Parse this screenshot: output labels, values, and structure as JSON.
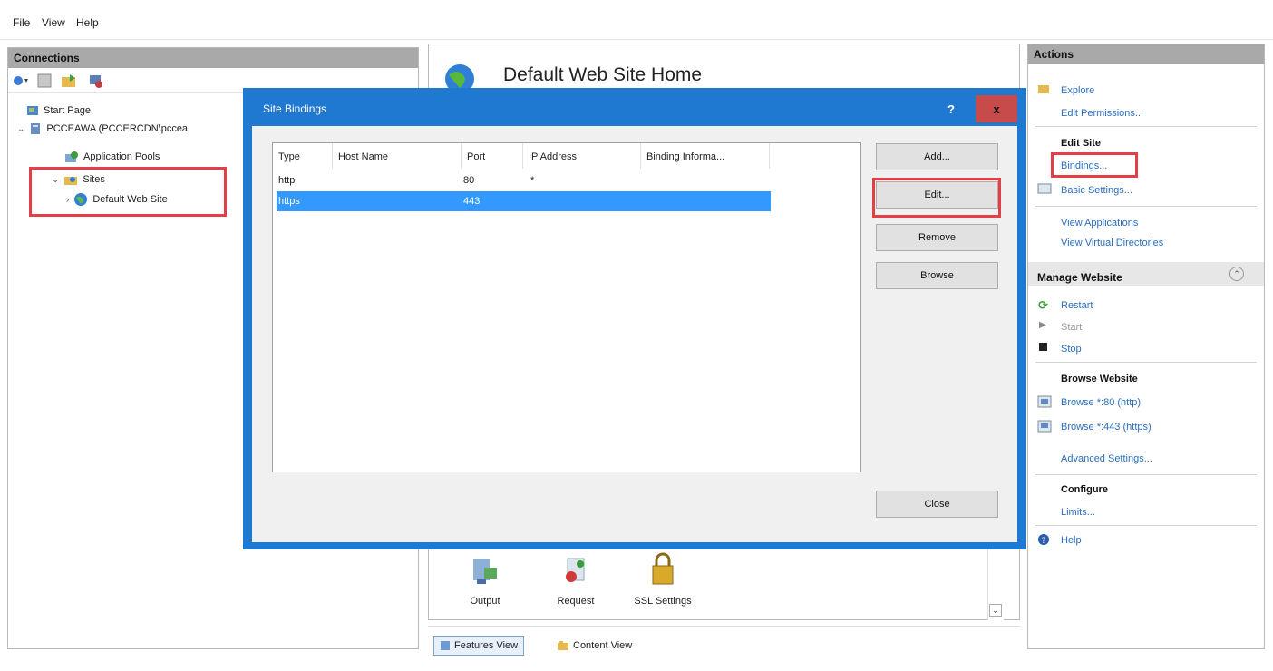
{
  "menu": [
    "File",
    "View",
    "Help"
  ],
  "connections": {
    "header": "Connections",
    "tree": {
      "start_page": "Start Page",
      "server": "PCCEAWA (PCCERCDN\\pccea",
      "app_pools": "Application Pools",
      "sites": "Sites",
      "default_site": "Default Web Site"
    }
  },
  "center": {
    "title": "Default Web Site Home",
    "features": [
      "Output",
      "Request",
      "SSL Settings"
    ],
    "views": {
      "features": "Features View",
      "content": "Content View"
    }
  },
  "actions": {
    "header": "Actions",
    "explore": "Explore",
    "edit_permissions": "Edit Permissions...",
    "edit_site": "Edit Site",
    "bindings": "Bindings...",
    "basic_settings": "Basic Settings...",
    "view_apps": "View Applications",
    "view_vdirs": "View Virtual Directories",
    "manage_website": "Manage Website",
    "restart": "Restart",
    "start": "Start",
    "stop": "Stop",
    "browse_website": "Browse Website",
    "browse80": "Browse *:80 (http)",
    "browse443": "Browse *:443 (https)",
    "advanced": "Advanced Settings...",
    "configure": "Configure",
    "limits": "Limits...",
    "help": "Help"
  },
  "dialog": {
    "title": "Site Bindings",
    "help_btn": "?",
    "close_x": "x",
    "columns": [
      "Type",
      "Host Name",
      "Port",
      "IP Address",
      "Binding Informa..."
    ],
    "rows": [
      {
        "type": "http",
        "host": "",
        "port": "80",
        "ip": "*"
      },
      {
        "type": "https",
        "host": "",
        "port": "443",
        "ip": ""
      }
    ],
    "buttons": {
      "add": "Add...",
      "edit": "Edit...",
      "remove": "Remove",
      "browse": "Browse",
      "close": "Close"
    }
  },
  "colors": {
    "dialog_frame": "#1f79d0",
    "selection": "#3399ff",
    "highlight": "#e23f46",
    "close_btn": "#c84b4b",
    "link": "#2a6ebf"
  }
}
